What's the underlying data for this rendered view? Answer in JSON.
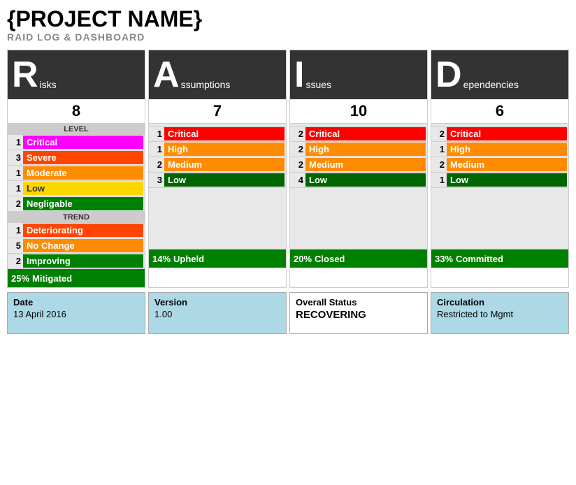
{
  "header": {
    "title": "{PROJECT NAME}",
    "subtitle": "RAID LOG & DASHBOARD"
  },
  "columns": [
    {
      "letter": "R",
      "label": "isks",
      "count": "8",
      "levels": [
        {
          "num": "1",
          "text": "Critical",
          "color": "bg-critical-pink"
        },
        {
          "num": "3",
          "text": "Severe",
          "color": "bg-severe"
        },
        {
          "num": "1",
          "text": "Moderate",
          "color": "bg-moderate"
        },
        {
          "num": "1",
          "text": "Low",
          "color": "bg-low-yellow"
        },
        {
          "num": "2",
          "text": "Negligable",
          "color": "bg-negligable"
        }
      ],
      "hasTrend": true,
      "trends": [
        {
          "num": "1",
          "text": "Deteriorating",
          "color": "bg-deteriorating"
        },
        {
          "num": "5",
          "text": "No Change",
          "color": "bg-no-change"
        },
        {
          "num": "2",
          "text": "Improving",
          "color": "bg-improving"
        }
      ],
      "mitigated_pct": "25%",
      "mitigated_label": "Mitigated"
    },
    {
      "letter": "A",
      "label": "ssumptions",
      "count": "7",
      "levels": [
        {
          "num": "1",
          "text": "Critical",
          "color": "bg-critical-red"
        },
        {
          "num": "1",
          "text": "High",
          "color": "bg-high"
        },
        {
          "num": "2",
          "text": "Medium",
          "color": "bg-medium"
        },
        {
          "num": "3",
          "text": "Low",
          "color": "bg-low-green"
        }
      ],
      "hasTrend": false,
      "mitigated_pct": "14%",
      "mitigated_label": "Upheld"
    },
    {
      "letter": "I",
      "label": "ssues",
      "count": "10",
      "levels": [
        {
          "num": "2",
          "text": "Critical",
          "color": "bg-critical-red"
        },
        {
          "num": "2",
          "text": "High",
          "color": "bg-high"
        },
        {
          "num": "2",
          "text": "Medium",
          "color": "bg-medium"
        },
        {
          "num": "4",
          "text": "Low",
          "color": "bg-low-green"
        }
      ],
      "hasTrend": false,
      "mitigated_pct": "20%",
      "mitigated_label": "Closed"
    },
    {
      "letter": "D",
      "label": "ependencies",
      "count": "6",
      "levels": [
        {
          "num": "2",
          "text": "Critical",
          "color": "bg-critical-red"
        },
        {
          "num": "1",
          "text": "High",
          "color": "bg-high"
        },
        {
          "num": "2",
          "text": "Medium",
          "color": "bg-medium"
        },
        {
          "num": "1",
          "text": "Low",
          "color": "bg-low-green"
        }
      ],
      "hasTrend": false,
      "mitigated_pct": "33%",
      "mitigated_label": "Committed"
    }
  ],
  "footer": [
    {
      "label": "Date",
      "value": "13 April 2016",
      "is_status": false
    },
    {
      "label": "Version",
      "value": "1.00",
      "is_status": false
    },
    {
      "label": "Overall Status",
      "value": "RECOVERING",
      "is_status": true
    },
    {
      "label": "Circulation",
      "value": "Restricted to Mgmt",
      "is_status": false
    }
  ]
}
